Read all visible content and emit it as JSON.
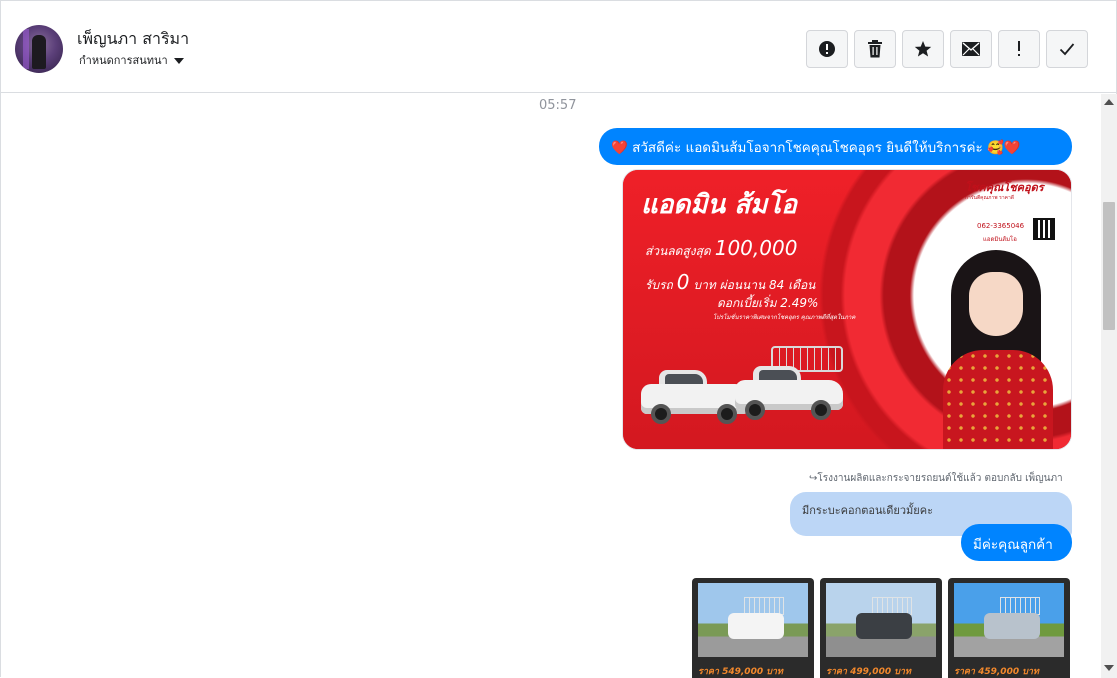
{
  "header": {
    "contact_name": "เพ็ญนภา สาริมา",
    "conversation_settings": "กำหนดการสนทนา",
    "toolbar": [
      {
        "name": "report-button",
        "icon": "alert-circle-icon"
      },
      {
        "name": "delete-button",
        "icon": "trash-icon"
      },
      {
        "name": "star-button",
        "icon": "star-icon"
      },
      {
        "name": "mark-unread-button",
        "icon": "envelope-icon"
      },
      {
        "name": "important-button",
        "icon": "exclamation-icon"
      },
      {
        "name": "mark-done-button",
        "icon": "checkmark-icon"
      }
    ]
  },
  "conversation": {
    "timestamp": "05:57",
    "greeting_message": "❤️ สวัสดีค่ะ แอดมินส้มโอจากโชคคุณโชคอุดร ยินดีให้บริการค่ะ 🥰❤️",
    "ad_image": {
      "title": "แอดมิน ส้มโอ",
      "line1_prefix": "ส่วนลดสูงสุด",
      "line1_value": "100,000",
      "line2_prefix": "รับรถ",
      "line2_value": "0",
      "line2_suffix": "บาท ผ่อนนาน 84 เดือน",
      "line3": "ดอกเบี้ยเริ่ม 2.49%",
      "line4": "โปรโมชั่นราคาพิเศษจากโชคอุดร คุณภาพดีที่สุดในภาค",
      "brand": "โชคคุณโชคอุดร",
      "brand_sub": "การันตีคุณภาพ ราคาดี",
      "phone": "062-3365046",
      "admin": "แอดมินส้มโอ"
    },
    "reply_label": "↪โรงงานผลิตและกระจายรถยนต์ใช้แล้ว ตอบกลับ เพ็ญนภา",
    "quoted_message": "มีกระบะคอกตอนเดียวมั้ยคะ",
    "reply_message": "มีค่ะคุณลูกค้า",
    "products": [
      {
        "price": "ราคา 549,000 บาท"
      },
      {
        "price": "ราคา 499,000 บาท"
      },
      {
        "price": "ราคา 459,000 บาท"
      }
    ]
  },
  "colors": {
    "accent_blue": "#0084ff",
    "quoted_bubble": "#bcd6f6",
    "ad_red": "#e21d25",
    "price_orange": "#f2882c"
  }
}
